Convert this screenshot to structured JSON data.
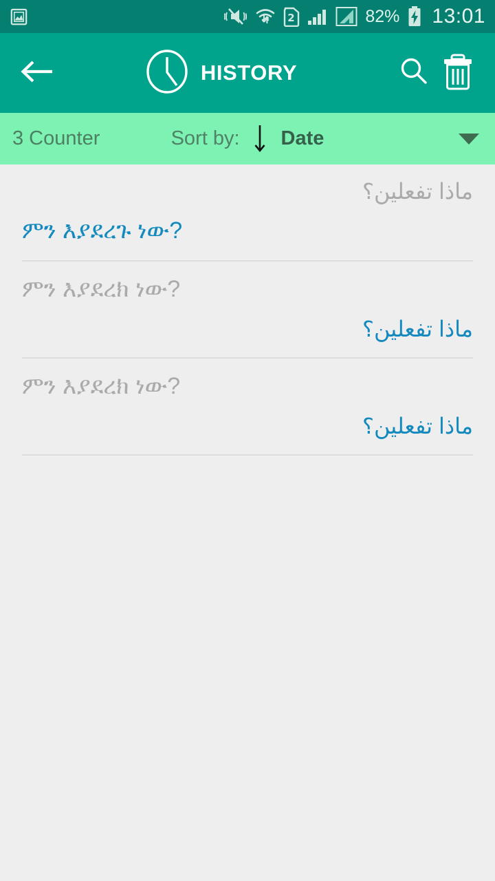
{
  "status_bar": {
    "background": "#057f6f",
    "notification_icon": "image-notification-icon",
    "icons": [
      "vibrate-mute-icon",
      "wifi-icon",
      "sim2-icon",
      "signal-bars-icon",
      "signal-bars-secondary-icon"
    ],
    "battery_percent": "82%",
    "battery_icon": "battery-charging-icon",
    "time": "13:01"
  },
  "app_bar": {
    "background": "#00a48d",
    "back_icon": "back-arrow-icon",
    "title_icon": "clock-icon",
    "title": "HISTORY",
    "search_icon": "search-icon",
    "delete_icon": "trash-icon"
  },
  "sort_bar": {
    "background": "#7df2b2",
    "counter": "3 Counter",
    "sort_label": "Sort by:",
    "sort_direction_icon": "arrow-down-icon",
    "sort_value": "Date",
    "dropdown_icon": "chevron-down-icon"
  },
  "accent_color": "#1389be",
  "muted_color": "#aaaaaa",
  "history": {
    "items": [
      {
        "first": "ماذا تفعلين؟",
        "first_dir": "rtl",
        "first_style": "source",
        "second": "ምን እያደረጉ ነው?",
        "second_dir": "ltr",
        "second_style": "target"
      },
      {
        "first": "ምን እያደረክ ነው?",
        "first_dir": "ltr",
        "first_style": "source",
        "second": "ماذا تفعلين؟",
        "second_dir": "rtl",
        "second_style": "target"
      },
      {
        "first": "ምን እያደረክ ነው?",
        "first_dir": "ltr",
        "first_style": "source",
        "second": "ماذا تفعلين؟",
        "second_dir": "rtl",
        "second_style": "target"
      }
    ]
  }
}
